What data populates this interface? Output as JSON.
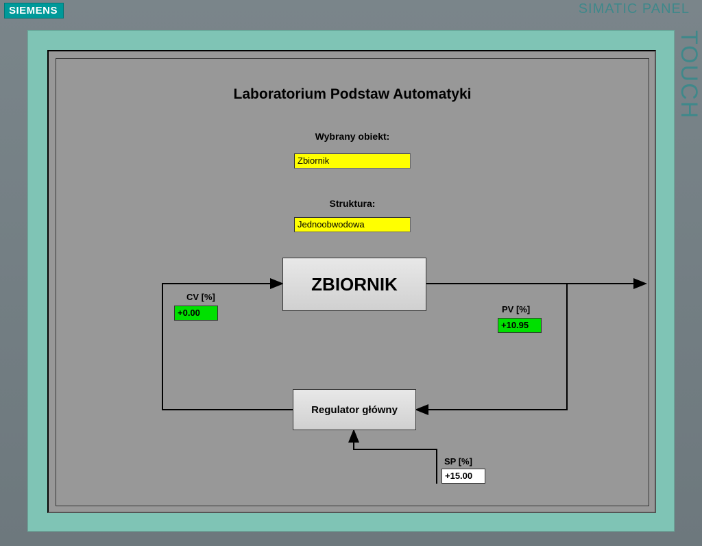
{
  "brand": {
    "logo": "SIEMENS",
    "product": "SIMATIC PANEL",
    "touch": "TOUCH"
  },
  "title": "Laboratorium Podstaw Automatyki",
  "selectors": {
    "object_label": "Wybrany obiekt:",
    "object_value": "Zbiornik",
    "structure_label": "Struktura:",
    "structure_value": "Jednoobwodowa"
  },
  "blocks": {
    "process": "ZBIORNIK",
    "controller": "Regulator główny"
  },
  "signals": {
    "cv": {
      "label": "CV [%]",
      "value": "+0.00"
    },
    "pv": {
      "label": "PV [%]",
      "value": "+10.95"
    },
    "sp": {
      "label": "SP [%]",
      "value": "+15.00"
    }
  }
}
